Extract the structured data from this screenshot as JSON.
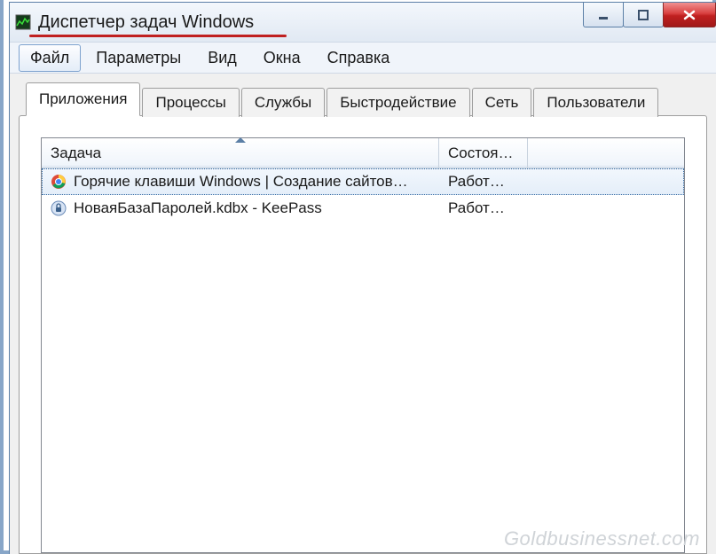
{
  "window": {
    "title": "Диспетчер задач Windows"
  },
  "menu": {
    "file": "Файл",
    "options": "Параметры",
    "view": "Вид",
    "windows": "Окна",
    "help": "Справка"
  },
  "tabs": {
    "applications": "Приложения",
    "processes": "Процессы",
    "services": "Службы",
    "performance": "Быстродействие",
    "network": "Сеть",
    "users": "Пользователи"
  },
  "columns": {
    "task": "Задача",
    "state": "Состоя…"
  },
  "rows": [
    {
      "icon": "chrome",
      "task": "Горячие клавиши Windows | Создание сайтов…",
      "state": "Работ…",
      "selected": true
    },
    {
      "icon": "keepass",
      "task": "НоваяБазаПаролей.kdbx - KeePass",
      "state": "Работ…",
      "selected": false
    }
  ],
  "watermark": "Goldbusinessnet.com"
}
